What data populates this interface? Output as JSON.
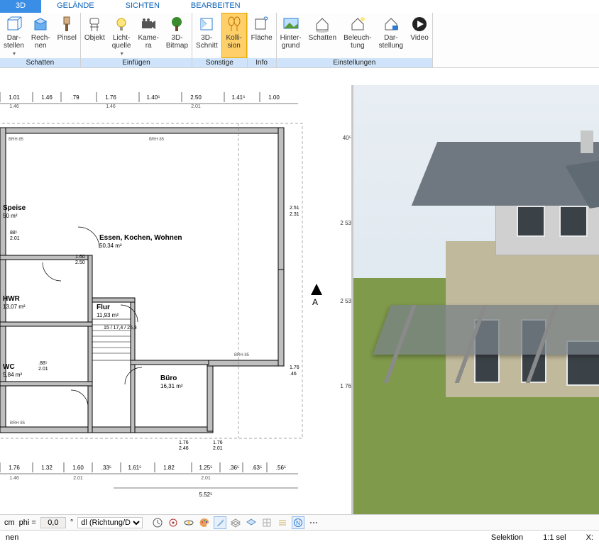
{
  "tabs": {
    "t0": "3D",
    "t1": "GELÄNDE",
    "t2": "SICHTEN",
    "t3": "BEARBEITEN"
  },
  "ribbon": {
    "schatten": {
      "title": "Schatten",
      "darstellen": "Dar-\nstellen",
      "rechnen": "Rech-\nnen",
      "pinsel": "Pinsel"
    },
    "einfuegen": {
      "title": "Einfügen",
      "objekt": "Objekt",
      "lichtquelle": "Licht-\nquelle",
      "kamera": "Kame-\nra",
      "bitmap": "3D-\nBitmap"
    },
    "sonstige": {
      "title": "Sonstige",
      "schnitt": "3D-\nSchnitt",
      "kollision": "Kolli-\nsion"
    },
    "info": {
      "title": "Info",
      "flaeche": "Fläche"
    },
    "einstellungen": {
      "title": "Einstellungen",
      "hintergrund": "Hinter-\ngrund",
      "schatten": "Schatten",
      "beleuchtung": "Beleuch-\ntung",
      "darstellung": "Dar-\nstellung",
      "video": "Video"
    }
  },
  "plan": {
    "rooms": {
      "speise_name": "Speise",
      "speise_area": "50 m²",
      "essen_name": "Essen, Kochen, Wohnen",
      "essen_area": "50,34 m²",
      "hwr_name": "HWR",
      "hwr_area": "13,07 m²",
      "flur_name": "Flur",
      "flur_area": "11,93 m²",
      "wc_name": "WC",
      "wc_area": "5,84 m²",
      "buero_name": "Büro",
      "buero_area": "16,31 m²"
    },
    "dims_top": [
      "1.01",
      "1.46",
      ".79",
      "1.76",
      "1.40⁵",
      "2.50",
      "1.41⁵",
      "1.00"
    ],
    "dims_top2": [
      "1.46",
      "",
      "",
      "1.46",
      "",
      "2.01",
      "",
      ""
    ],
    "dims_bottom": [
      "1.76",
      "1.32",
      "1.60",
      ".33⁵",
      "1.61⁵",
      "1.82",
      "1.25⁵",
      ".36⁵",
      ".63⁵",
      ".56⁵"
    ],
    "dims_bottom2": [
      "1.46",
      "",
      "2.01",
      "",
      "",
      "",
      "2.01",
      "",
      "",
      ""
    ],
    "dim_bottom_total": "5.52⁵",
    "dim_right_pairs": [
      "2.51 / 2.31",
      "1.76 / .46"
    ],
    "dim_vert_pairs": [
      "88⁵ / 2.01",
      ".88⁵ / 2.01",
      "1.60 / 2.50",
      "1.76 / 2.01",
      "1.76 / 2.46"
    ],
    "brh": "BRH 85",
    "stair_label": "15 / 17,4 / 26,3",
    "section_marker": "A",
    "ruler_ticks": [
      "40⁵",
      "2 53",
      "2 53",
      "1 76"
    ]
  },
  "inputbar": {
    "unit": "cm",
    "phi_label": "phi =",
    "phi_value": "0,0",
    "degree": "°",
    "direction_label": "dl (Richtung/Di"
  },
  "statusbar": {
    "left": "nen",
    "selektion": "Selektion",
    "ratio": "1:1 sel",
    "x_label": "X:"
  }
}
